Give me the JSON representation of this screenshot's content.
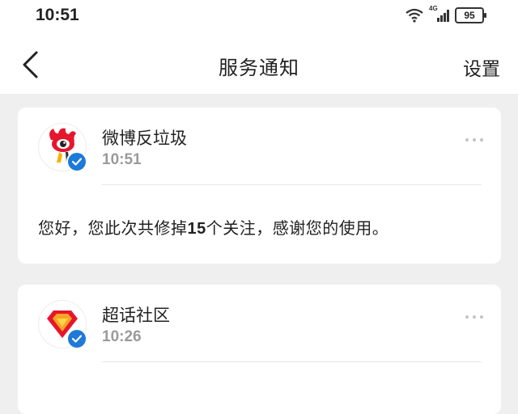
{
  "status_bar": {
    "time": "10:51",
    "network": "4G",
    "battery": "95"
  },
  "nav": {
    "title": "服务通知",
    "settings_label": "设置"
  },
  "notifications": [
    {
      "sender": "微博反垃圾",
      "time": "10:51",
      "avatar_icon": "weibo-logo-icon",
      "message_pre": "您好，您此次共修掉",
      "message_count": "15",
      "message_post": "个关注，感谢您的使用。"
    },
    {
      "sender": "超话社区",
      "time": "10:26",
      "avatar_icon": "supertopic-diamond-icon"
    }
  ],
  "colors": {
    "verified": "#1e7ad8",
    "background": "#efefef",
    "weibo_red": "#e6162d"
  }
}
